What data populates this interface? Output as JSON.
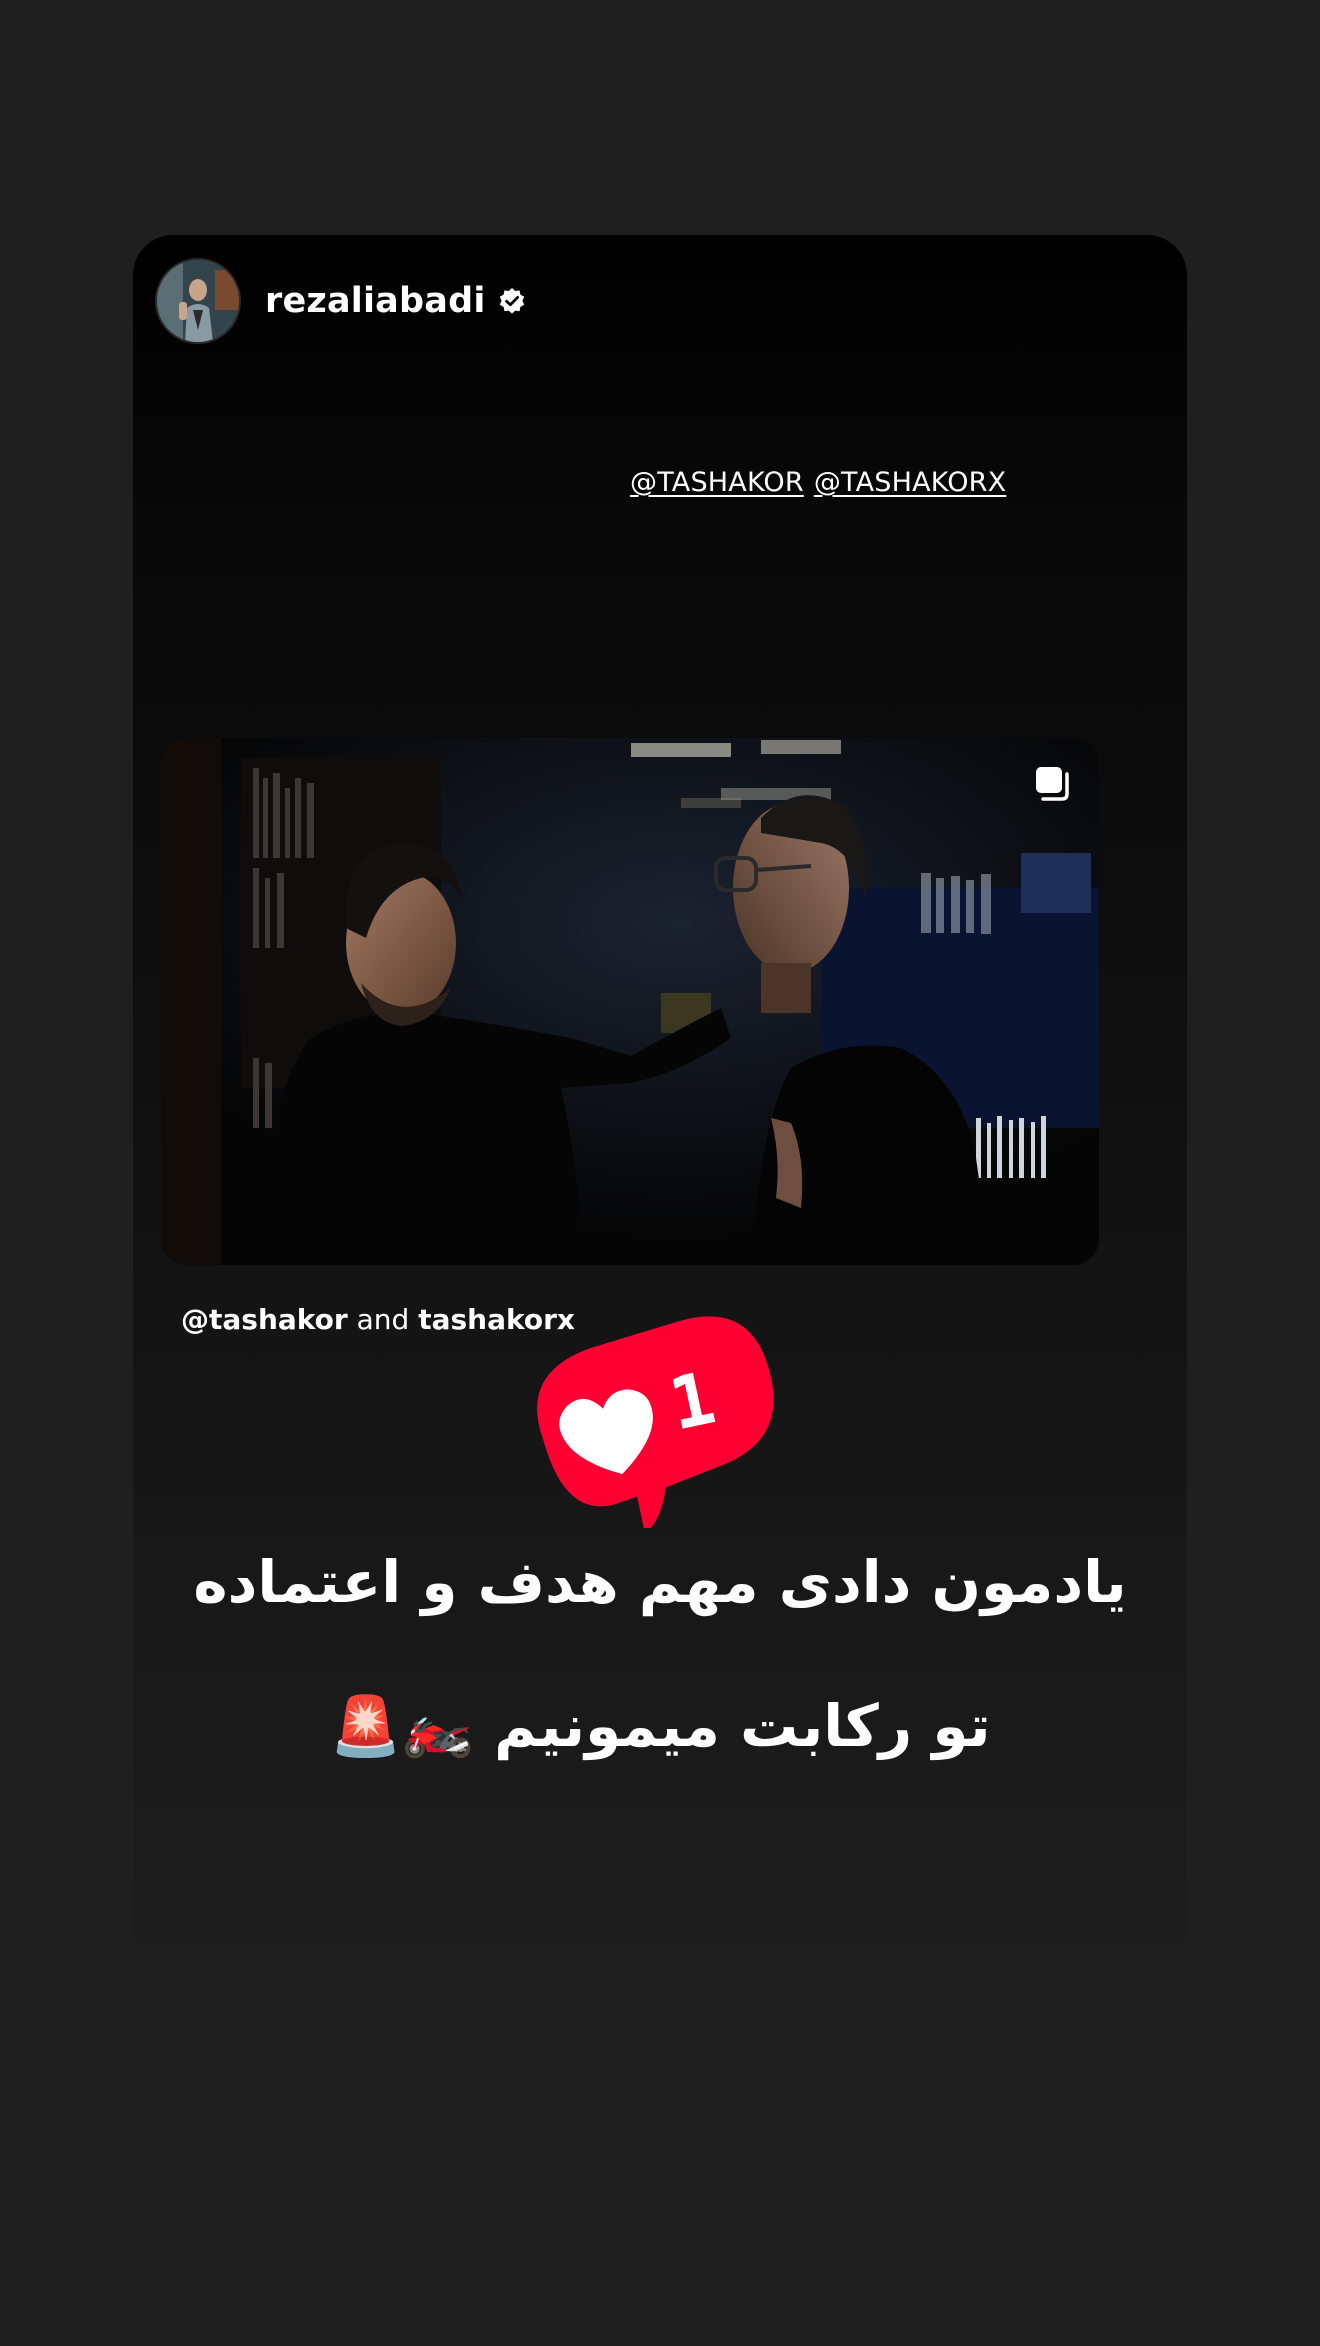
{
  "story": {
    "username": "rezaliabadi",
    "verified": true,
    "mentions": [
      "@TASHAKOR",
      "@TASHAKORX"
    ],
    "credit": {
      "handle": "@tashakor",
      "joiner": "and",
      "second": "tashakorx"
    },
    "like_count": "1",
    "caption_line1": "یادمون دادی مهم هدف و اعتماده",
    "caption_line2": "تو رکابت میمونیم 🏍️🚨"
  },
  "icons": {
    "verified": "verified-badge-icon",
    "multi": "multiple-posts-icon",
    "heart": "heart-icon"
  },
  "colors": {
    "background": "#1f1f1f",
    "card_top": "#000000",
    "like_sticker": "#ff0033",
    "text": "#ffffff"
  }
}
